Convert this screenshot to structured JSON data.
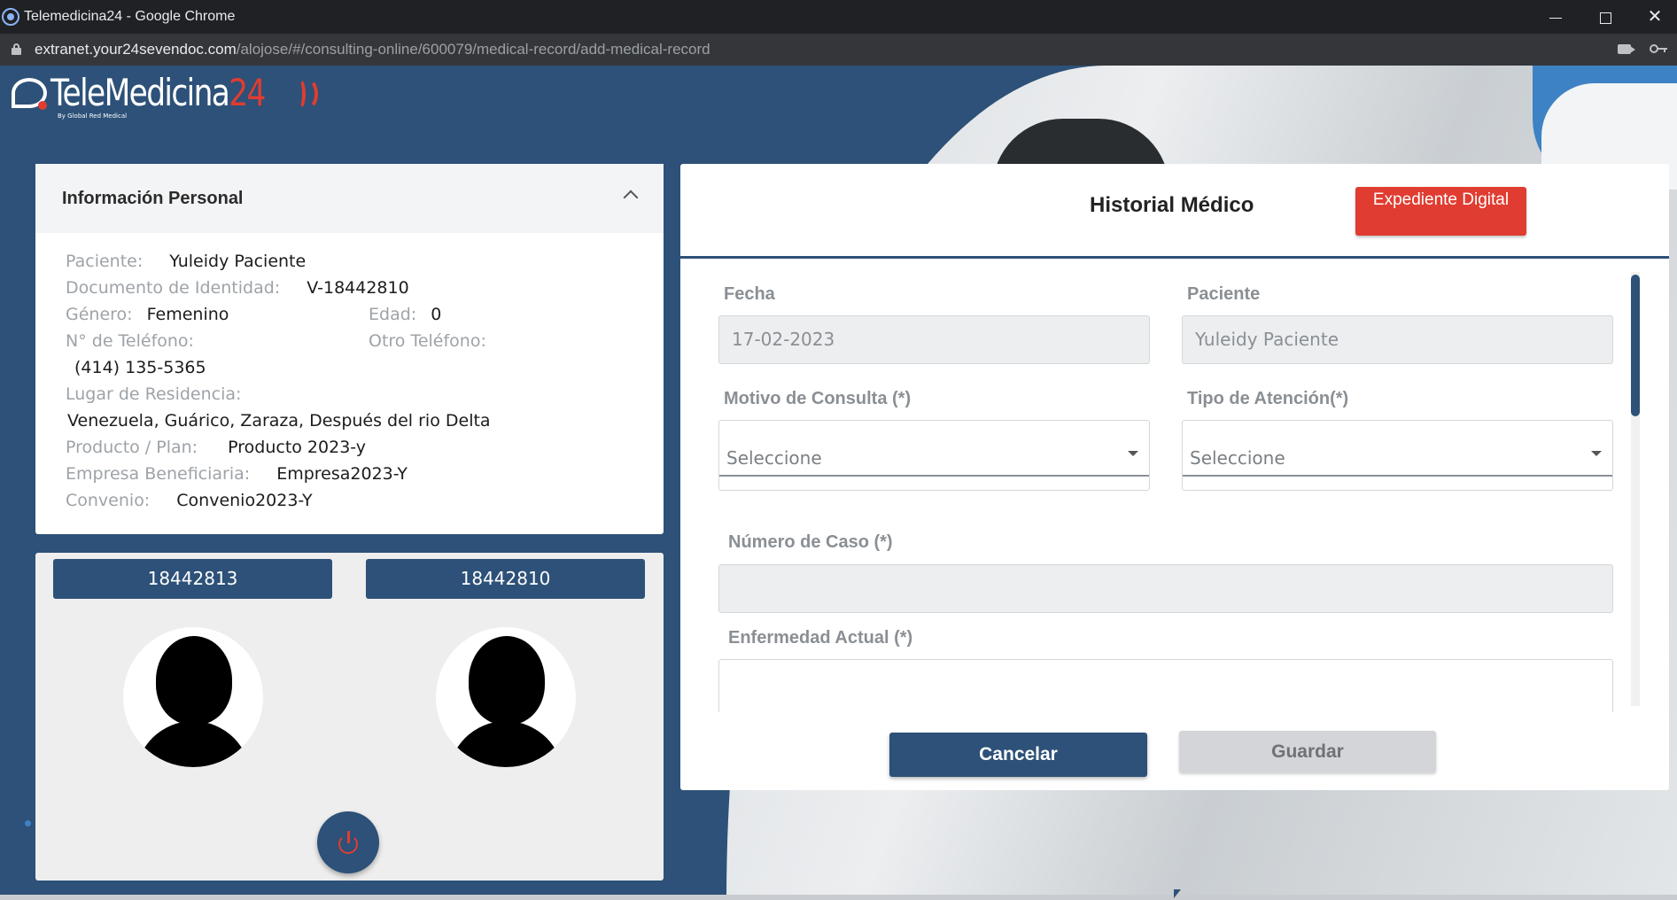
{
  "browser": {
    "window_title": "Telemedicina24 - Google Chrome",
    "url_domain": "extranet.your24sevendoc.com",
    "url_path": "/alojose/#/consulting-online/600079/medical-record/add-medical-record"
  },
  "logo": {
    "name_text": "TeleMedicina",
    "name_number": "24",
    "tagline": "By Global Red Medical"
  },
  "personal_info": {
    "title": "Información Personal",
    "patient_label": "Paciente:",
    "patient_value": "Yuleidy Paciente",
    "document_label": "Documento de Identidad:",
    "document_value": "V-18442810",
    "gender_label": "Género:",
    "gender_value": "Femenino",
    "age_label": "Edad:",
    "age_value": "0",
    "phone_label": "N° de Teléfono:",
    "other_phone_label": "Otro Teléfono:",
    "phone_value": "(414) 135-5365",
    "residence_label": "Lugar de Residencia:",
    "residence_value": "Venezuela, Guárico, Zaraza, Después del rio Delta",
    "product_label": "Producto / Plan:",
    "product_value": "Producto 2023-y",
    "company_label": "Empresa Beneficiaria:",
    "company_value": "Empresa2023-Y",
    "agreement_label": "Convenio:",
    "agreement_value": "Convenio2023-Y"
  },
  "participants": {
    "left_id": "18442813",
    "right_id": "18442810"
  },
  "medical_record": {
    "title": "Historial Médico",
    "digital_file_button": "Expediente Digital",
    "date_label": "Fecha",
    "date_value": "17-02-2023",
    "patient_label": "Paciente",
    "patient_value": "Yuleidy Paciente",
    "reason_label": "Motivo de Consulta (*)",
    "reason_value": "Seleccione",
    "attention_label": "Tipo de Atención(*)",
    "attention_value": "Seleccione",
    "case_label": "Número de Caso (*)",
    "case_value": "",
    "illness_label": "Enfermedad Actual (*)",
    "cancel_button": "Cancelar",
    "save_button": "Guardar"
  },
  "colors": {
    "primary": "#2d5178",
    "accent_red": "#e03c31",
    "muted_label": "#9ea3a8"
  },
  "icons": [
    "shield-favicon-icon",
    "lock-icon",
    "camera-icon",
    "key-icon",
    "chevron-up-icon",
    "avatar-icon",
    "power-icon",
    "dropdown-caret-icon"
  ]
}
